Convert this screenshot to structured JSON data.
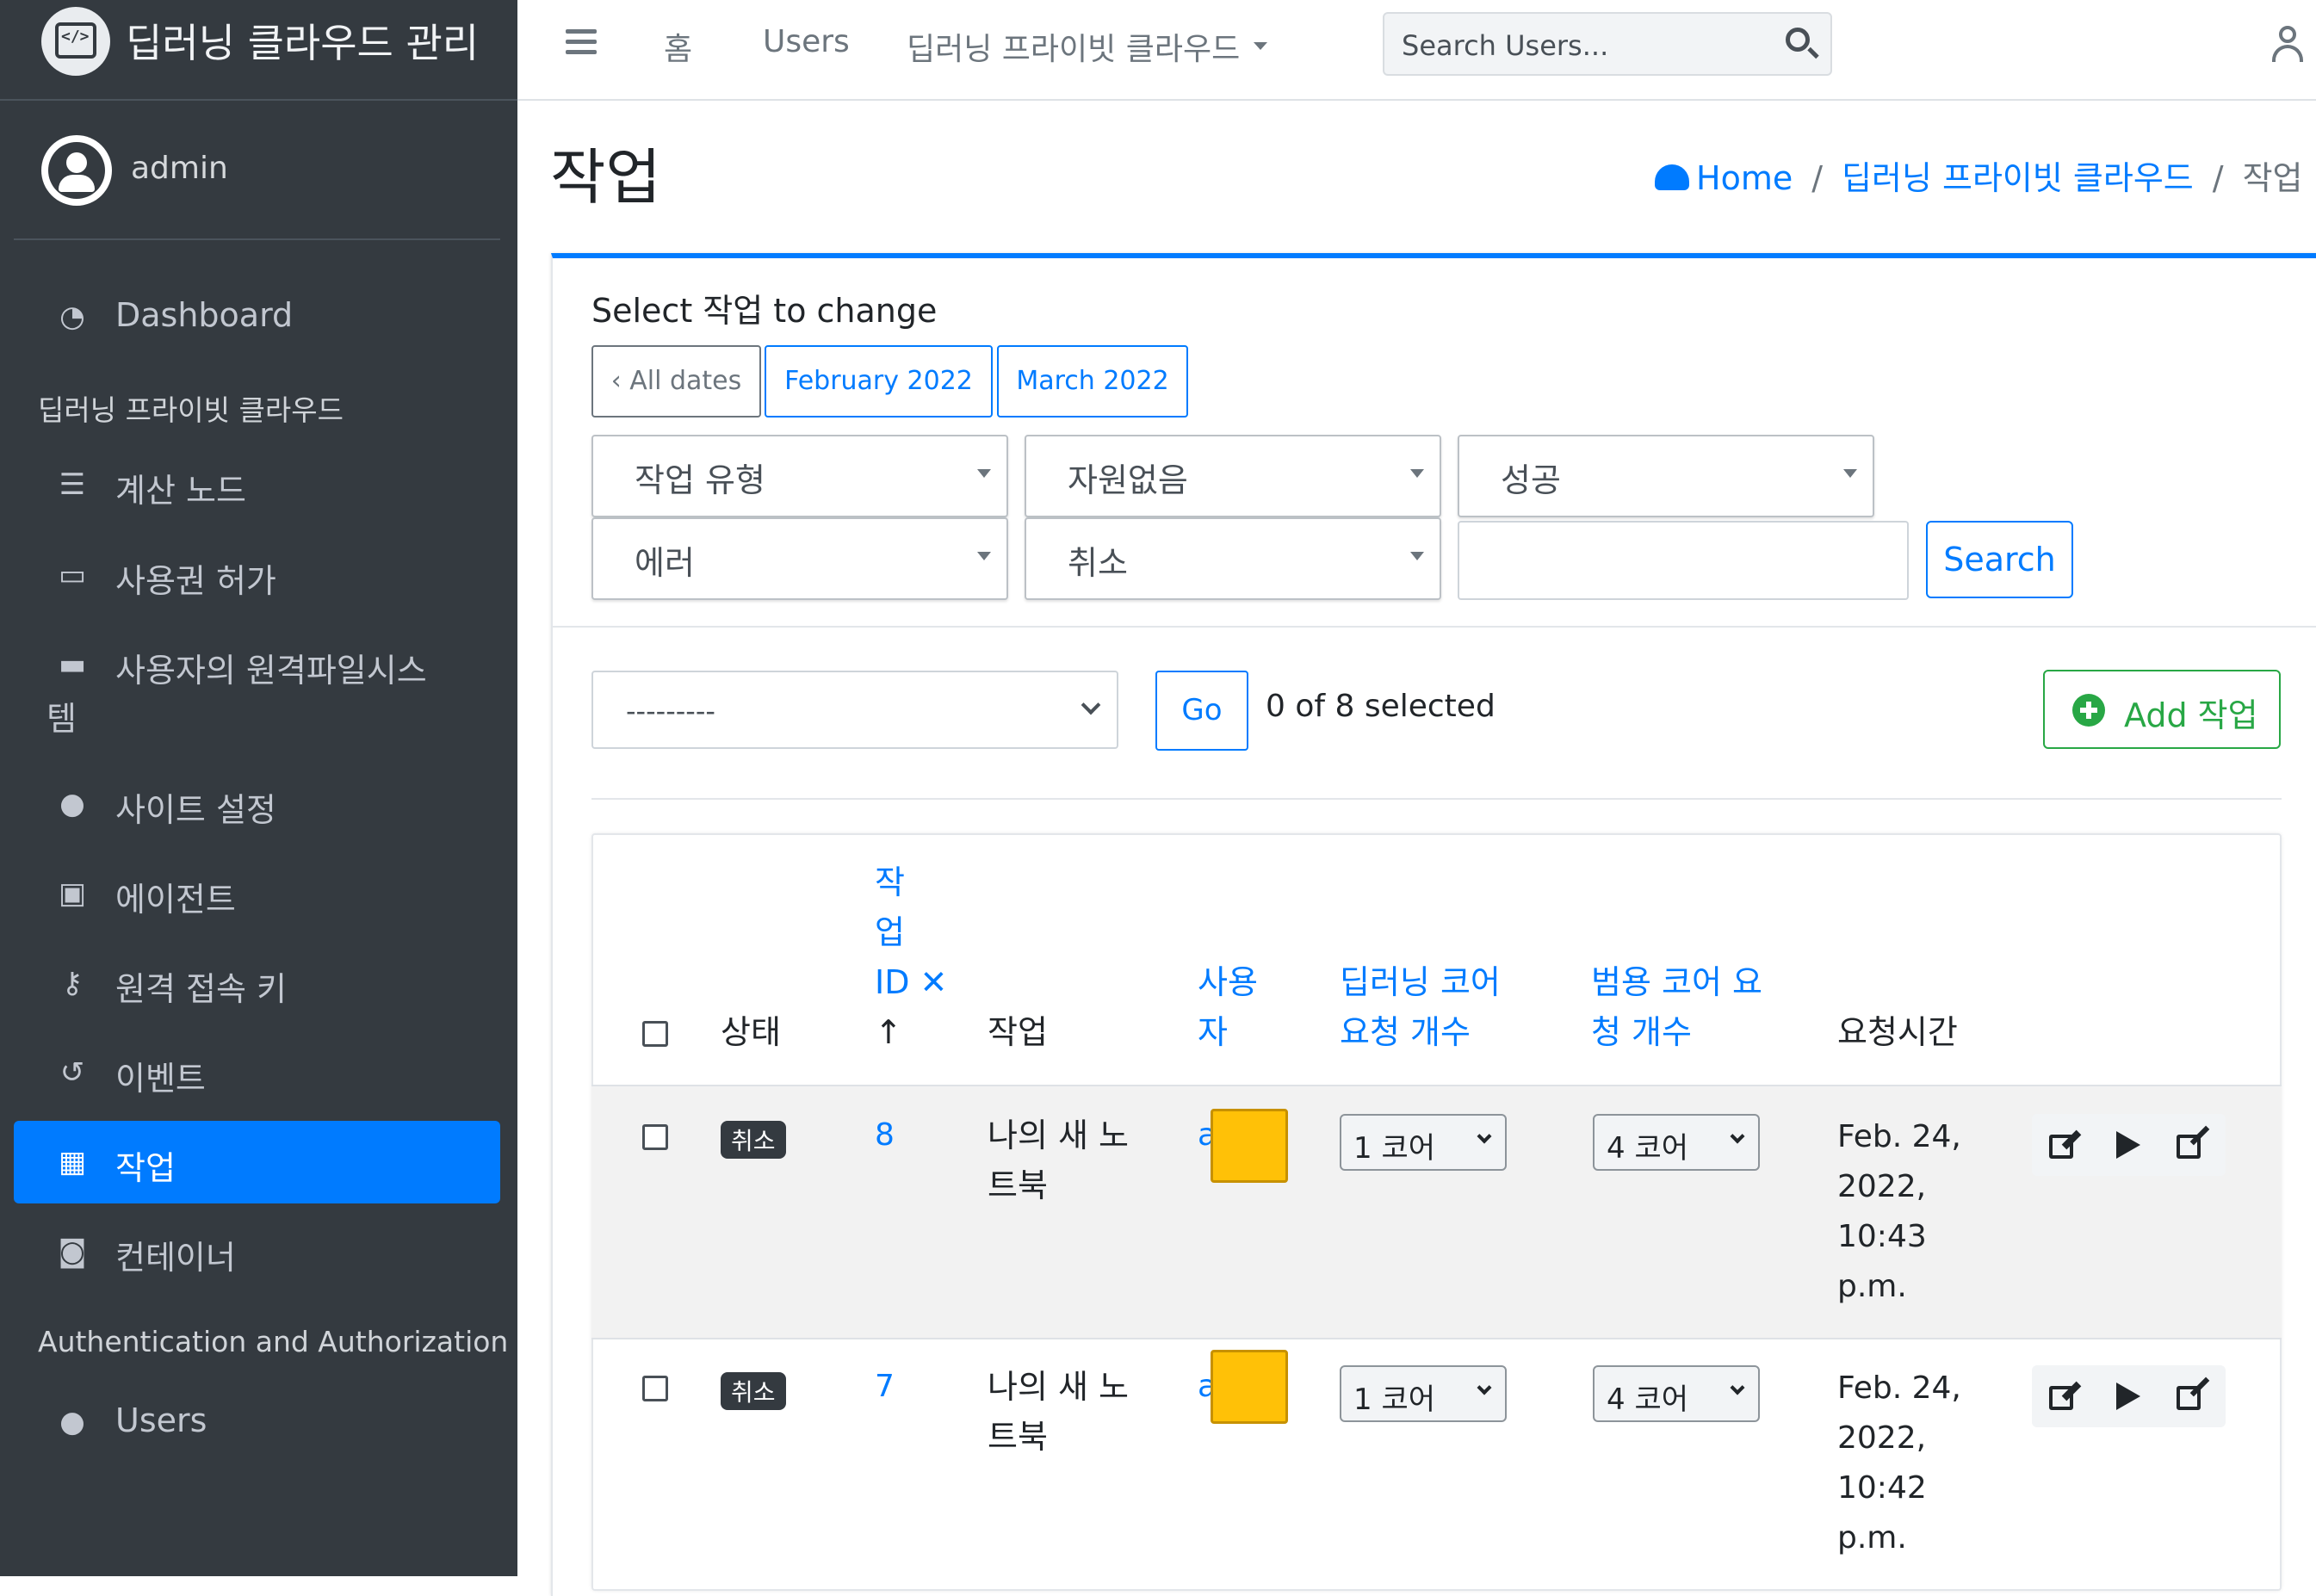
{
  "app": {
    "brand_title": "딥러닝 클라우드 관리"
  },
  "user": {
    "name": "admin"
  },
  "sidebar": {
    "dashboard": "Dashboard",
    "section1": "딥러닝 프라이빗 클라우드",
    "items": [
      {
        "label": "계산 노드",
        "icon": "server-icon"
      },
      {
        "label": "사용권 허가",
        "icon": "license-icon"
      },
      {
        "label": "사용자의 원격파일시스",
        "label2": "템",
        "icon": "hdd-icon"
      },
      {
        "label": "사이트 설정",
        "icon": "circle-icon"
      },
      {
        "label": "에이전트",
        "icon": "robot-icon"
      },
      {
        "label": "원격 접속 키",
        "icon": "key-icon"
      },
      {
        "label": "이벤트",
        "icon": "history-icon"
      },
      {
        "label": "작업",
        "icon": "microchip-icon",
        "active": true
      },
      {
        "label": "컨테이너",
        "icon": "docker-icon"
      }
    ],
    "section2": "Authentication and Authorization",
    "users": "Users"
  },
  "topbar": {
    "home": "홈",
    "users": "Users",
    "dropdown": "딥러닝 프라이빗 클라우드",
    "search_placeholder": "Search Users..."
  },
  "page": {
    "title": "작업",
    "breadcrumb": {
      "home": "Home",
      "section": "딥러닝 프라이빗 클라우드",
      "current": "작업"
    }
  },
  "changelist": {
    "heading": "Select 작업 to change",
    "date_hierarchy": {
      "all": "‹ All dates",
      "feb": "February 2022",
      "mar": "March 2022"
    },
    "filters": {
      "type": "작업 유형",
      "resource": "자원없음",
      "success": "성공",
      "error": "에러",
      "cancel": "취소"
    },
    "search_button": "Search",
    "action_default": "---------",
    "go_button": "Go",
    "selected_count": "0 of 8 selected",
    "add_button": "Add 작업"
  },
  "table": {
    "headers": {
      "status": "상태",
      "id_line1": "작",
      "id_line2": "업",
      "id_line3": "ID ✕",
      "id_line4": "↑",
      "job": "작업",
      "user1": "사용",
      "user2": "자",
      "dl1": "딥러닝 코어",
      "dl2": "요청 개수",
      "gen1": "범용 코어 요",
      "gen2": "청 개수",
      "time": "요청시간"
    },
    "rows": [
      {
        "status": "취소",
        "id": "8",
        "job1": "나의 새 노",
        "job2": "트북",
        "user": "a",
        "dl": "1 코어",
        "gen": "4 코어",
        "t1": "Feb. 24,",
        "t2": "2022,",
        "t3": "10:43",
        "t4": "p.m."
      },
      {
        "status": "취소",
        "id": "7",
        "job1": "나의 새 노",
        "job2": "트북",
        "user": "a",
        "dl": "1 코어",
        "gen": "4 코어",
        "t1": "Feb. 24,",
        "t2": "2022,",
        "t3": "10:42",
        "t4": "p.m."
      }
    ]
  },
  "colors": {
    "primary": "#007bff",
    "sidebar": "#343a40",
    "success": "#28a745"
  }
}
